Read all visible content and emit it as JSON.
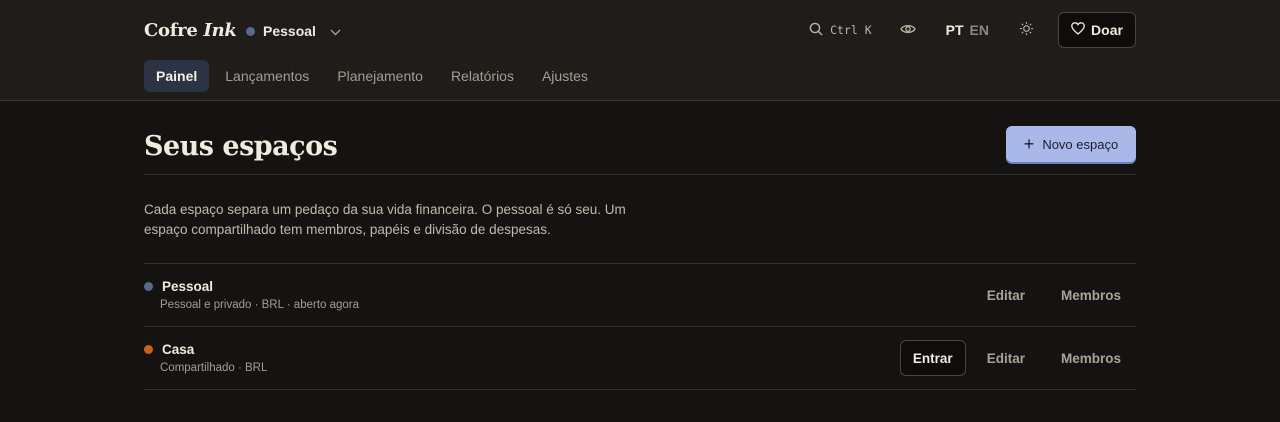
{
  "brand": {
    "name_regular": "Cofre",
    "name_italic": "Ink"
  },
  "space_switcher": {
    "label": "Pessoal",
    "color": "#5a6a8c"
  },
  "search": {
    "shortcut": "Ctrl K"
  },
  "language": {
    "active": "PT",
    "inactive": "EN"
  },
  "donate": {
    "label": "Doar"
  },
  "tabs": [
    {
      "label": "Painel",
      "active": true
    },
    {
      "label": "Lançamentos",
      "active": false
    },
    {
      "label": "Planejamento",
      "active": false
    },
    {
      "label": "Relatórios",
      "active": false
    },
    {
      "label": "Ajustes",
      "active": false
    }
  ],
  "page": {
    "title": "Seus espaços",
    "new_button": "Novo espaço",
    "description_line1": "Cada espaço separa um pedaço da sua vida financeira. O pessoal é só seu. Um",
    "description_line2": "espaço compartilhado tem membros, papéis e divisão de despesas."
  },
  "spaces": [
    {
      "name": "Pessoal",
      "meta": "Pessoal e privado · BRL · aberto agora",
      "color": "#5a6a8c",
      "edit_label": "Editar",
      "members_label": "Membros"
    },
    {
      "name": "Casa",
      "meta": "Compartilhado · BRL",
      "color": "#c8631f",
      "enter_label": "Entrar",
      "edit_label": "Editar",
      "members_label": "Membros"
    }
  ],
  "colors": {
    "accent": "#a9b8e8",
    "active_tab": "#2b3344",
    "background": "#151311"
  }
}
